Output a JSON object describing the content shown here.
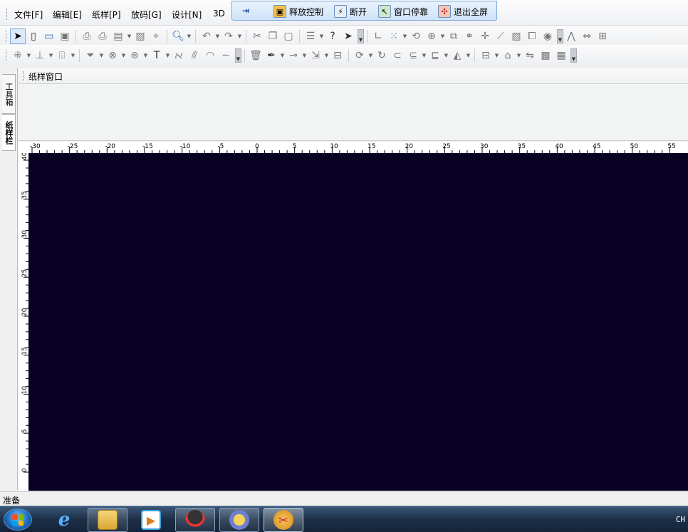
{
  "menu": {
    "items": [
      "文件[F]",
      "编辑[E]",
      "纸样[P]",
      "放码[G]",
      "设计[N]",
      "3D"
    ]
  },
  "remote_bar": {
    "buttons": [
      {
        "label": "释放控制",
        "icon": "release-control-icon"
      },
      {
        "label": "断开",
        "icon": "disconnect-icon"
      },
      {
        "label": "窗口停靠",
        "icon": "dock-window-icon"
      },
      {
        "label": "退出全屏",
        "icon": "exit-fullscreen-icon"
      }
    ]
  },
  "side_tabs": [
    "工具箱",
    "纸样栏"
  ],
  "pattern_panel": {
    "title": "纸样窗口"
  },
  "rulers": {
    "horizontal": {
      "min": -30,
      "max": 55,
      "step": 5
    },
    "vertical": {
      "min": 0,
      "max": 40,
      "step": 5
    }
  },
  "status": {
    "text": "准备"
  },
  "taskbar": {
    "apps": [
      "internet-explorer-icon",
      "file-explorer-icon",
      "media-player-icon",
      "qq-icon",
      "remote-desktop-icon",
      "garment-cad-icon"
    ],
    "tray_language": "CH"
  },
  "colors": {
    "canvas": "#090124",
    "accent": "#1d5fb5"
  }
}
